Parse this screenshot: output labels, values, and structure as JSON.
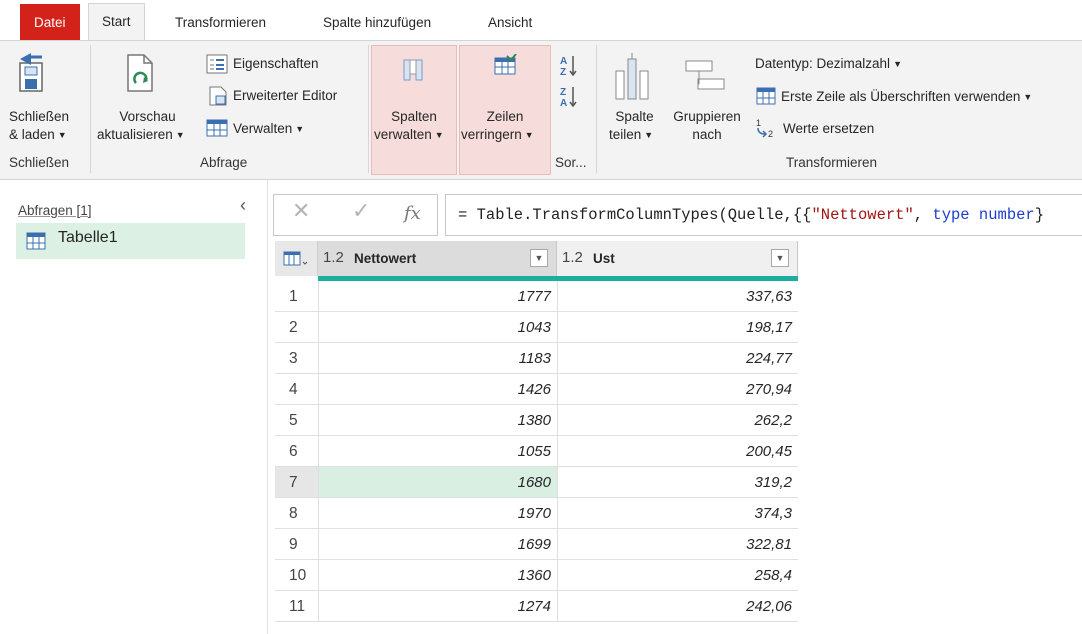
{
  "tabs": {
    "file": "Datei",
    "start": "Start",
    "transform": "Transformieren",
    "add_column": "Spalte hinzufügen",
    "view": "Ansicht"
  },
  "ribbon": {
    "close_load": [
      "Schließen",
      "& laden"
    ],
    "refresh_preview": [
      "Vorschau",
      "aktualisieren"
    ],
    "properties": "Eigenschaften",
    "advanced_editor": "Erweiterter Editor",
    "manage": "Verwalten",
    "manage_columns": [
      "Spalten",
      "verwalten"
    ],
    "reduce_rows": [
      "Zeilen",
      "verringern"
    ],
    "split_column": [
      "Spalte",
      "teilen"
    ],
    "group_by": [
      "Gruppieren",
      "nach"
    ],
    "data_type": "Datentyp: Dezimalzahl",
    "first_row_headers": "Erste Zeile als Überschriften verwenden",
    "replace_values": "Werte ersetzen",
    "groups": {
      "close": "Schließen",
      "query": "Abfrage",
      "sort": "Sor...",
      "transform": "Transformieren"
    }
  },
  "queries": {
    "title": "Abfragen [1]",
    "items": [
      "Tabelle1"
    ]
  },
  "formula": {
    "fx": "fx",
    "prefix": "= Table.TransformColumnTypes(Quelle,{{",
    "str": "\"Nettowert\"",
    "mid": ", ",
    "kw": "type number",
    "suffix": "}"
  },
  "table": {
    "columns": [
      {
        "type": "1.2",
        "name": "Nettowert"
      },
      {
        "type": "1.2",
        "name": "Ust"
      }
    ],
    "rows": [
      {
        "n": "1",
        "netto": "1777",
        "ust": "337,63"
      },
      {
        "n": "2",
        "netto": "1043",
        "ust": "198,17"
      },
      {
        "n": "3",
        "netto": "1183",
        "ust": "224,77"
      },
      {
        "n": "4",
        "netto": "1426",
        "ust": "270,94"
      },
      {
        "n": "5",
        "netto": "1380",
        "ust": "262,2"
      },
      {
        "n": "6",
        "netto": "1055",
        "ust": "200,45"
      },
      {
        "n": "7",
        "netto": "1680",
        "ust": "319,2"
      },
      {
        "n": "8",
        "netto": "1970",
        "ust": "374,3"
      },
      {
        "n": "9",
        "netto": "1699",
        "ust": "322,81"
      },
      {
        "n": "10",
        "netto": "1360",
        "ust": "258,4"
      },
      {
        "n": "11",
        "netto": "1274",
        "ust": "242,06"
      }
    ],
    "selected_row": "7"
  },
  "colors": {
    "file_tab": "#d32219",
    "accent_teal": "#1baf9f",
    "selection": "#d9efe2",
    "highlight_group": "#f6dcda"
  }
}
